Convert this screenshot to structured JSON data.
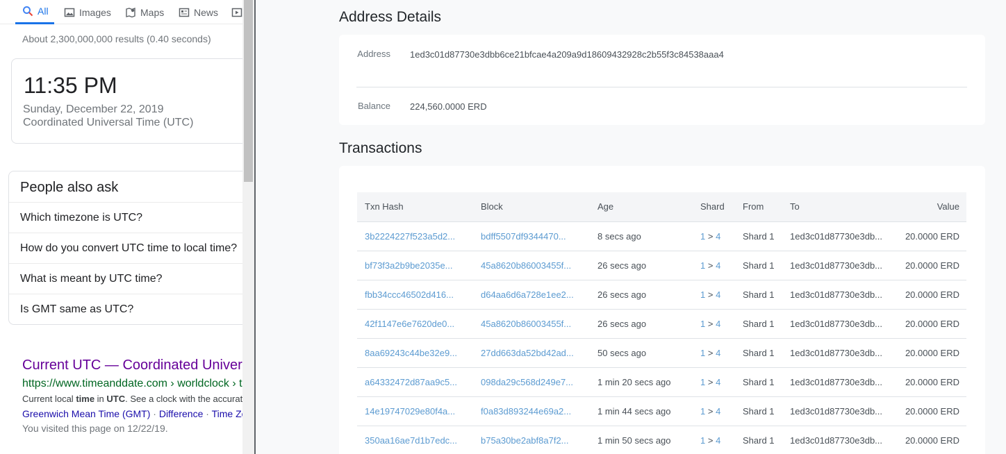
{
  "google": {
    "tabs": [
      {
        "label": "All",
        "icon": "search-icon",
        "active": true
      },
      {
        "label": "Images",
        "icon": "image-icon"
      },
      {
        "label": "Maps",
        "icon": "map-icon"
      },
      {
        "label": "News",
        "icon": "news-icon"
      }
    ],
    "result_stats": "About 2,300,000,000 results (0.40 seconds)",
    "time_card": {
      "time": "11:35 PM",
      "date": "Sunday, December 22, 2019",
      "zone": "Coordinated Universal Time (UTC)"
    },
    "people_also_ask": {
      "title": "People also ask",
      "questions": [
        "Which timezone is UTC?",
        "How do you convert UTC time to local time?",
        "What is meant by UTC time?",
        "Is GMT same as UTC?"
      ]
    },
    "result": {
      "title": "Current UTC — Coordinated Universal Time",
      "url": "https://www.timeanddate.com › worldclock › timezone",
      "snippet_pre": "Current local ",
      "snippet_b1": "time",
      "snippet_mid": " in ",
      "snippet_b2": "UTC",
      "snippet_post": ". See a clock with the accurate time",
      "links": [
        "Greenwich Mean Time (GMT)",
        "Difference",
        "Time Zone"
      ],
      "visited": "You visited this page on 12/22/19."
    }
  },
  "explorer": {
    "address_details_title": "Address Details",
    "address_label": "Address",
    "address_value": "1ed3c01d87730e3dbb6ce21bfcae4a209a9d18609432928c2b55f3c84538aaa4",
    "balance_label": "Balance",
    "balance_value": "224,560.0000 ERD",
    "transactions_title": "Transactions",
    "columns": {
      "hash": "Txn Hash",
      "block": "Block",
      "age": "Age",
      "shard": "Shard",
      "from": "From",
      "to": "To",
      "value": "Value"
    },
    "rows": [
      {
        "hash": "3b2224227f523a5d2...",
        "block": "bdff5507df9344470...",
        "age": "8 secs ago",
        "shard_from": "1",
        "shard_to": "4",
        "from": "Shard 1",
        "to": "1ed3c01d87730e3db...",
        "value": "20.0000 ERD"
      },
      {
        "hash": "bf73f3a2b9be2035e...",
        "block": "45a8620b86003455f...",
        "age": "26 secs ago",
        "shard_from": "1",
        "shard_to": "4",
        "from": "Shard 1",
        "to": "1ed3c01d87730e3db...",
        "value": "20.0000 ERD"
      },
      {
        "hash": "fbb34ccc46502d416...",
        "block": "d64aa6d6a728e1ee2...",
        "age": "26 secs ago",
        "shard_from": "1",
        "shard_to": "4",
        "from": "Shard 1",
        "to": "1ed3c01d87730e3db...",
        "value": "20.0000 ERD"
      },
      {
        "hash": "42f1147e6e7620de0...",
        "block": "45a8620b86003455f...",
        "age": "26 secs ago",
        "shard_from": "1",
        "shard_to": "4",
        "from": "Shard 1",
        "to": "1ed3c01d87730e3db...",
        "value": "20.0000 ERD"
      },
      {
        "hash": "8aa69243c44be32e9...",
        "block": "27dd663da52bd42ad...",
        "age": "50 secs ago",
        "shard_from": "1",
        "shard_to": "4",
        "from": "Shard 1",
        "to": "1ed3c01d87730e3db...",
        "value": "20.0000 ERD"
      },
      {
        "hash": "a64332472d87aa9c5...",
        "block": "098da29c568d249e7...",
        "age": "1 min 20 secs ago",
        "shard_from": "1",
        "shard_to": "4",
        "from": "Shard 1",
        "to": "1ed3c01d87730e3db...",
        "value": "20.0000 ERD"
      },
      {
        "hash": "14e19747029e80f4a...",
        "block": "f0a83d893244e69a2...",
        "age": "1 min 44 secs ago",
        "shard_from": "1",
        "shard_to": "4",
        "from": "Shard 1",
        "to": "1ed3c01d87730e3db...",
        "value": "20.0000 ERD"
      },
      {
        "hash": "350aa16ae7d1b7edc...",
        "block": "b75a30be2abf8a7f2...",
        "age": "1 min 50 secs ago",
        "shard_from": "1",
        "shard_to": "4",
        "from": "Shard 1",
        "to": "1ed3c01d87730e3db...",
        "value": "20.0000 ERD"
      }
    ]
  },
  "colors": {
    "accent": "#1a73e8",
    "link": "#5c9bd1",
    "visited": "#660099",
    "url_green": "#006621"
  }
}
